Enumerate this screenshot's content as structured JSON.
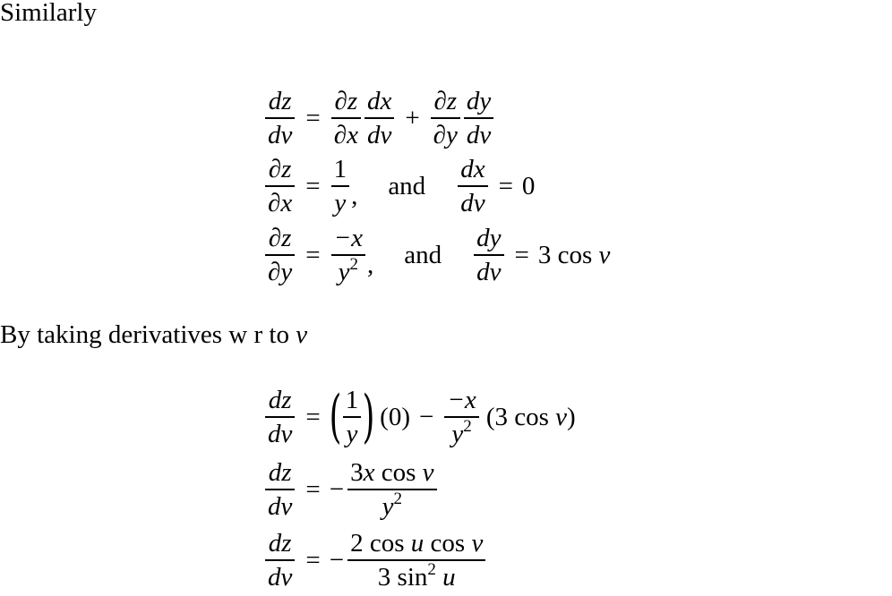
{
  "paragraphs": {
    "intro": "Similarly",
    "derivatives": "By taking derivatives w r to ",
    "derivatives_var": "v"
  },
  "block1": {
    "eq1": {
      "lhs_num": "dz",
      "lhs_den": "dv",
      "eq": "=",
      "t1_num": "∂z",
      "t1_den": "∂x",
      "t2_num": "dx",
      "t2_den": "dv",
      "plus": "+",
      "t3_num": "∂z",
      "t3_den": "∂y",
      "t4_num": "dy",
      "t4_den": "dv"
    },
    "eq2": {
      "lhs_num": "∂z",
      "lhs_den": "∂x",
      "eq": "=",
      "rhs_num": "1",
      "rhs_den": "y",
      "comma": ",",
      "and": "and",
      "r2_num": "dx",
      "r2_den": "dv",
      "eq2": "=",
      "r2_val": "0"
    },
    "eq3": {
      "lhs_num": "∂z",
      "lhs_den": "∂y",
      "eq": "=",
      "rhs_num": "−x",
      "rhs_den_base": "y",
      "rhs_den_exp": "2",
      "comma": ",",
      "and": "and",
      "r2_num": "dy",
      "r2_den": "dv",
      "eq2": "=",
      "r2_val_coef": "3 cos ",
      "r2_val_var": "v"
    }
  },
  "block2": {
    "eq1": {
      "lhs_num": "dz",
      "lhs_den": "dv",
      "eq": "=",
      "lparen": "(",
      "p_num": "1",
      "p_den": "y",
      "rparen": ")",
      "zero": "(0)",
      "minus": "−",
      "f_num": "−x",
      "f_den_base": "y",
      "f_den_exp": "2",
      "tail_open": "(3 cos ",
      "tail_var": "v",
      "tail_close": ")"
    },
    "eq2": {
      "lhs_num": "dz",
      "lhs_den": "dv",
      "eq": "=",
      "minus": "−",
      "num_a": "3",
      "num_x": "x",
      "num_cos": " cos ",
      "num_v": "v",
      "den_base": "y",
      "den_exp": "2"
    },
    "eq3": {
      "lhs_num": "dz",
      "lhs_den": "dv",
      "eq": "=",
      "minus": "−",
      "num_a": "2 cos ",
      "num_u": "u",
      "num_cos": " cos ",
      "num_v": "v",
      "den_a": "3 sin",
      "den_exp": "2",
      "den_u": "u"
    }
  }
}
